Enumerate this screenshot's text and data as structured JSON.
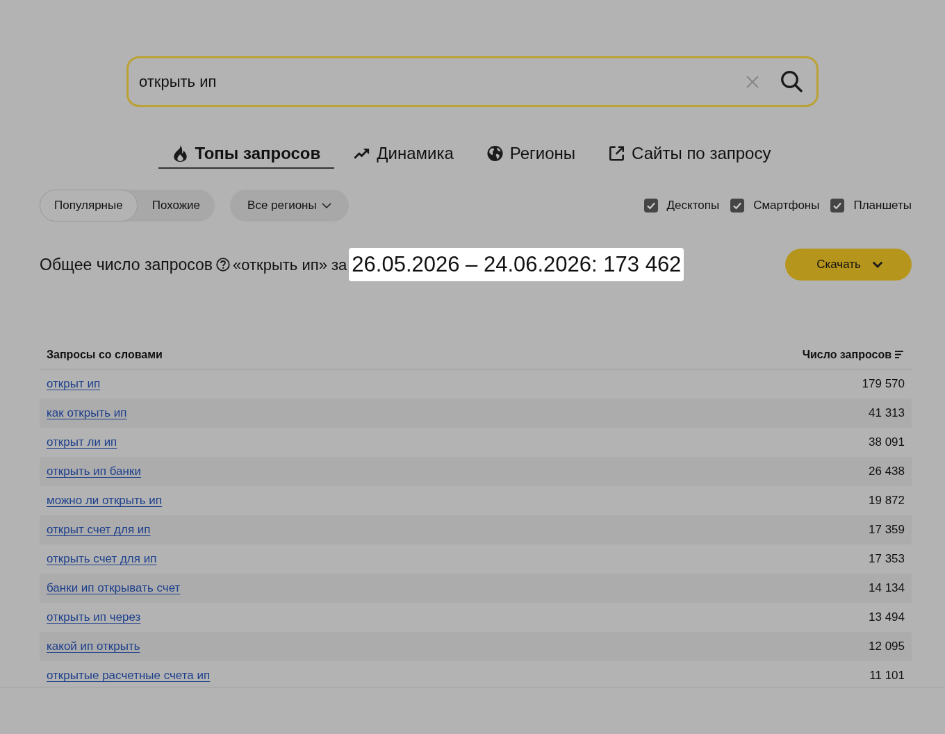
{
  "search": {
    "value": "открыть ип"
  },
  "tabs": [
    {
      "label": "Топы запросов",
      "selected": true
    },
    {
      "label": "Динамика",
      "selected": false
    },
    {
      "label": "Регионы",
      "selected": false
    },
    {
      "label": "Сайты по запросу",
      "selected": false
    }
  ],
  "modes": [
    {
      "label": "Популярные",
      "selected": true
    },
    {
      "label": "Похожие",
      "selected": false
    }
  ],
  "region_dropdown": {
    "label": "Все регионы"
  },
  "devices": [
    {
      "label": "Десктопы",
      "checked": true
    },
    {
      "label": "Смартфоны",
      "checked": true
    },
    {
      "label": "Планшеты",
      "checked": true
    }
  ],
  "summary": {
    "label": "Общее число запросов",
    "query": "«открыть ип» за",
    "highlight": "26.05.2026 – 24.06.2026: 173 462"
  },
  "download_button": {
    "label": "Скачать"
  },
  "table": {
    "columns": [
      "Запросы со словами",
      "Число запросов"
    ],
    "rows": [
      {
        "query": "открыт ип",
        "count": "179 570"
      },
      {
        "query": "как открыть ип",
        "count": "41 313"
      },
      {
        "query": "открыт ли ип",
        "count": "38 091"
      },
      {
        "query": "открыть ип банки",
        "count": "26 438"
      },
      {
        "query": "можно ли открыть ип",
        "count": "19 872"
      },
      {
        "query": "открыт счет для ип",
        "count": "17 359"
      },
      {
        "query": "открыть счет для ип",
        "count": "17 353"
      },
      {
        "query": "банки ип открывать счет",
        "count": "14 134"
      },
      {
        "query": "открыть ип через",
        "count": "13 494"
      },
      {
        "query": "какой ип открыть",
        "count": "12 095"
      },
      {
        "query": "открытые расчетные счета ип",
        "count": "11 101"
      }
    ]
  }
}
